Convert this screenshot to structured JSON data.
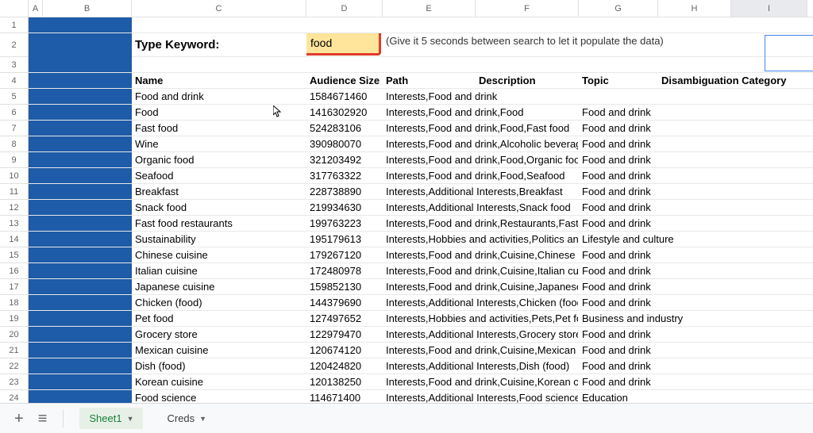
{
  "columns": [
    "A",
    "B",
    "C",
    "D",
    "E",
    "F",
    "G",
    "H",
    "I"
  ],
  "row_numbers": [
    1,
    2,
    3,
    4,
    5,
    6,
    7,
    8,
    9,
    10,
    11,
    12,
    13,
    14,
    15,
    16,
    17,
    18,
    19,
    20,
    21,
    22,
    23,
    24
  ],
  "keyword_label": "Type Keyword:",
  "keyword_value": "food",
  "hint": "(Give it 5 seconds between search to let it populate the data)",
  "headers": {
    "name": "Name",
    "audience": "Audience Size",
    "path": "Path",
    "description": "Description",
    "topic": "Topic",
    "disamb": "Disambiguation Category"
  },
  "rows": [
    {
      "name": "Food and drink",
      "size": "1584671460",
      "path": "Interests,Food and drink",
      "topic": ""
    },
    {
      "name": "Food",
      "size": "1416302920",
      "path": "Interests,Food and drink,Food",
      "topic": "Food and drink"
    },
    {
      "name": "Fast food",
      "size": "524283106",
      "path": "Interests,Food and drink,Food,Fast food",
      "topic": "Food and drink"
    },
    {
      "name": "Wine",
      "size": "390980070",
      "path": "Interests,Food and drink,Alcoholic beverag",
      "topic": "Food and drink"
    },
    {
      "name": "Organic food",
      "size": "321203492",
      "path": "Interests,Food and drink,Food,Organic foo",
      "topic": "Food and drink"
    },
    {
      "name": "Seafood",
      "size": "317763322",
      "path": "Interests,Food and drink,Food,Seafood",
      "topic": "Food and drink"
    },
    {
      "name": "Breakfast",
      "size": "228738890",
      "path": "Interests,Additional Interests,Breakfast",
      "topic": "Food and drink"
    },
    {
      "name": "Snack food",
      "size": "219934630",
      "path": "Interests,Additional Interests,Snack food",
      "topic": "Food and drink"
    },
    {
      "name": "Fast food restaurants",
      "size": "199763223",
      "path": "Interests,Food and drink,Restaurants,Fast",
      "topic": "Food and drink"
    },
    {
      "name": "Sustainability",
      "size": "195179613",
      "path": "Interests,Hobbies and activities,Politics and",
      "topic": "Lifestyle and culture"
    },
    {
      "name": "Chinese cuisine",
      "size": "179267120",
      "path": "Interests,Food and drink,Cuisine,Chinese c",
      "topic": "Food and drink"
    },
    {
      "name": "Italian cuisine",
      "size": "172480978",
      "path": "Interests,Food and drink,Cuisine,Italian cui",
      "topic": "Food and drink"
    },
    {
      "name": "Japanese cuisine",
      "size": "159852130",
      "path": "Interests,Food and drink,Cuisine,Japanese",
      "topic": "Food and drink"
    },
    {
      "name": "Chicken (food)",
      "size": "144379690",
      "path": "Interests,Additional Interests,Chicken (food",
      "topic": "Food and drink"
    },
    {
      "name": "Pet food",
      "size": "127497652",
      "path": "Interests,Hobbies and activities,Pets,Pet fo",
      "topic": "Business and industry"
    },
    {
      "name": "Grocery store",
      "size": "122979470",
      "path": "Interests,Additional Interests,Grocery store",
      "topic": "Food and drink"
    },
    {
      "name": "Mexican cuisine",
      "size": "120674120",
      "path": "Interests,Food and drink,Cuisine,Mexican c",
      "topic": "Food and drink"
    },
    {
      "name": "Dish (food)",
      "size": "120424820",
      "path": "Interests,Additional Interests,Dish (food)",
      "topic": "Food and drink"
    },
    {
      "name": "Korean cuisine",
      "size": "120138250",
      "path": "Interests,Food and drink,Cuisine,Korean cu",
      "topic": "Food and drink"
    },
    {
      "name": "Food science",
      "size": "114671400",
      "path": "Interests,Additional Interests,Food science",
      "topic": "Education"
    }
  ],
  "tabs": {
    "add": "+",
    "all": "≡",
    "sheet1": "Sheet1",
    "creds": "Creds"
  }
}
